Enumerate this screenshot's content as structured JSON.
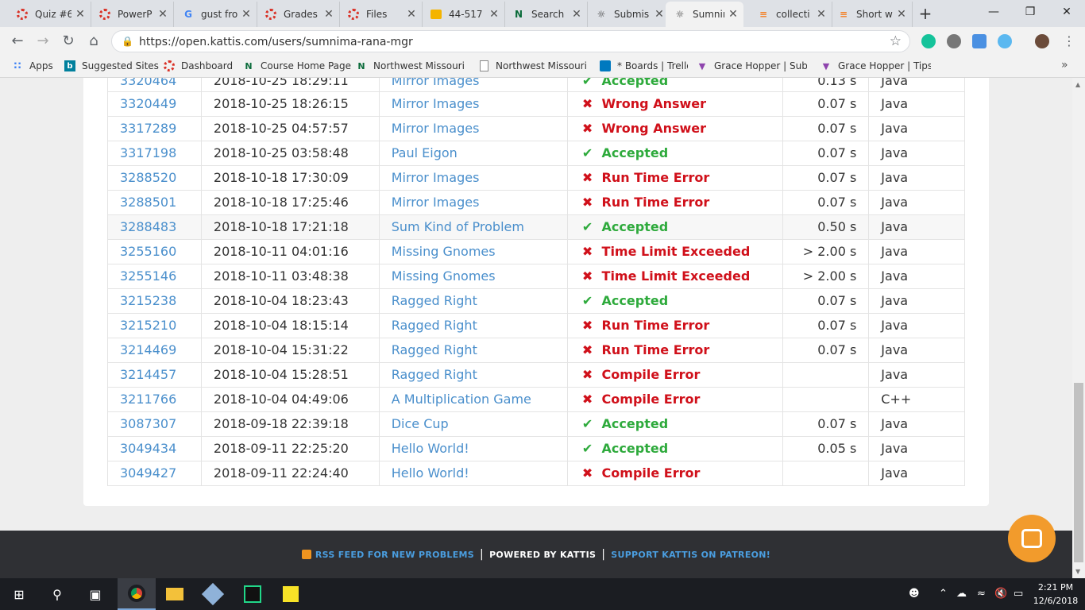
{
  "browser": {
    "tabs": [
      {
        "label": "Quiz #6",
        "icon": "canvas-icon"
      },
      {
        "label": "PowerP",
        "icon": "canvas-icon"
      },
      {
        "label": "gust fro",
        "icon": "google-icon"
      },
      {
        "label": "Grades",
        "icon": "canvas-icon"
      },
      {
        "label": "Files",
        "icon": "canvas-icon"
      },
      {
        "label": "44-517",
        "icon": "slides-icon"
      },
      {
        "label": "Search",
        "icon": "northwest-icon"
      },
      {
        "label": "Submis",
        "icon": "kattis-icon"
      },
      {
        "label": "Sumnin",
        "icon": "kattis-icon"
      },
      {
        "label": "collecti",
        "icon": "stackoverflow-icon"
      },
      {
        "label": "Short w",
        "icon": "stackoverflow-icon"
      }
    ],
    "url": "https://open.kattis.com/users/sumnima-rana-mgr",
    "bookmarks": [
      {
        "label": "Apps",
        "icon": "apps-grid-icon"
      },
      {
        "label": "Suggested Sites",
        "icon": "bing-icon"
      },
      {
        "label": "Dashboard",
        "icon": "canvas-icon"
      },
      {
        "label": "Course Home Page",
        "icon": "northwest-icon"
      },
      {
        "label": "Northwest Missouri S",
        "icon": "northwest-icon"
      },
      {
        "label": "Northwest Missouri S",
        "icon": "document-icon"
      },
      {
        "label": "* Boards | Trello",
        "icon": "trello-icon"
      },
      {
        "label": "Grace Hopper | Subm",
        "icon": "grace-hopper-icon"
      },
      {
        "label": "Grace Hopper | Tips f",
        "icon": "grace-hopper-icon"
      }
    ]
  },
  "submissions": [
    {
      "id": "3320464",
      "date": "2018-10-25 18:29:11",
      "problem": "Mirror Images",
      "status": "Accepted",
      "ok": true,
      "time": "0.13 s",
      "lang": "Java"
    },
    {
      "id": "3320449",
      "date": "2018-10-25 18:26:15",
      "problem": "Mirror Images",
      "status": "Wrong Answer",
      "ok": false,
      "time": "0.07 s",
      "lang": "Java"
    },
    {
      "id": "3317289",
      "date": "2018-10-25 04:57:57",
      "problem": "Mirror Images",
      "status": "Wrong Answer",
      "ok": false,
      "time": "0.07 s",
      "lang": "Java"
    },
    {
      "id": "3317198",
      "date": "2018-10-25 03:58:48",
      "problem": "Paul Eigon",
      "status": "Accepted",
      "ok": true,
      "time": "0.07 s",
      "lang": "Java"
    },
    {
      "id": "3288520",
      "date": "2018-10-18 17:30:09",
      "problem": "Mirror Images",
      "status": "Run Time Error",
      "ok": false,
      "time": "0.07 s",
      "lang": "Java"
    },
    {
      "id": "3288501",
      "date": "2018-10-18 17:25:46",
      "problem": "Mirror Images",
      "status": "Run Time Error",
      "ok": false,
      "time": "0.07 s",
      "lang": "Java"
    },
    {
      "id": "3288483",
      "date": "2018-10-18 17:21:18",
      "problem": "Sum Kind of Problem",
      "status": "Accepted",
      "ok": true,
      "time": "0.50 s",
      "lang": "Java"
    },
    {
      "id": "3255160",
      "date": "2018-10-11 04:01:16",
      "problem": "Missing Gnomes",
      "status": "Time Limit Exceeded",
      "ok": false,
      "time": "> 2.00 s",
      "lang": "Java"
    },
    {
      "id": "3255146",
      "date": "2018-10-11 03:48:38",
      "problem": "Missing Gnomes",
      "status": "Time Limit Exceeded",
      "ok": false,
      "time": "> 2.00 s",
      "lang": "Java"
    },
    {
      "id": "3215238",
      "date": "2018-10-04 18:23:43",
      "problem": "Ragged Right",
      "status": "Accepted",
      "ok": true,
      "time": "0.07 s",
      "lang": "Java"
    },
    {
      "id": "3215210",
      "date": "2018-10-04 18:15:14",
      "problem": "Ragged Right",
      "status": "Run Time Error",
      "ok": false,
      "time": "0.07 s",
      "lang": "Java"
    },
    {
      "id": "3214469",
      "date": "2018-10-04 15:31:22",
      "problem": "Ragged Right",
      "status": "Run Time Error",
      "ok": false,
      "time": "0.07 s",
      "lang": "Java"
    },
    {
      "id": "3214457",
      "date": "2018-10-04 15:28:51",
      "problem": "Ragged Right",
      "status": "Compile Error",
      "ok": false,
      "time": "",
      "lang": "Java"
    },
    {
      "id": "3211766",
      "date": "2018-10-04 04:49:06",
      "problem": "A Multiplication Game",
      "status": "Compile Error",
      "ok": false,
      "time": "",
      "lang": "C++"
    },
    {
      "id": "3087307",
      "date": "2018-09-18 22:39:18",
      "problem": "Dice Cup",
      "status": "Accepted",
      "ok": true,
      "time": "0.07 s",
      "lang": "Java"
    },
    {
      "id": "3049434",
      "date": "2018-09-11 22:25:20",
      "problem": "Hello World!",
      "status": "Accepted",
      "ok": true,
      "time": "0.05 s",
      "lang": "Java"
    },
    {
      "id": "3049427",
      "date": "2018-09-11 22:24:40",
      "problem": "Hello World!",
      "status": "Compile Error",
      "ok": false,
      "time": "",
      "lang": "Java"
    }
  ],
  "footer": {
    "rss": "RSS FEED FOR NEW PROBLEMS",
    "powered": "POWERED BY KATTIS",
    "patreon": "SUPPORT KATTIS ON PATREON!"
  },
  "taskbar": {
    "time": "2:21 PM",
    "date": "12/6/2018"
  },
  "colors": {
    "accepted": "#2eaa3c",
    "error": "#d0101a",
    "link": "#4a8fcc",
    "chat_button": "#f29b2c",
    "footer_bg": "#2f3034"
  }
}
